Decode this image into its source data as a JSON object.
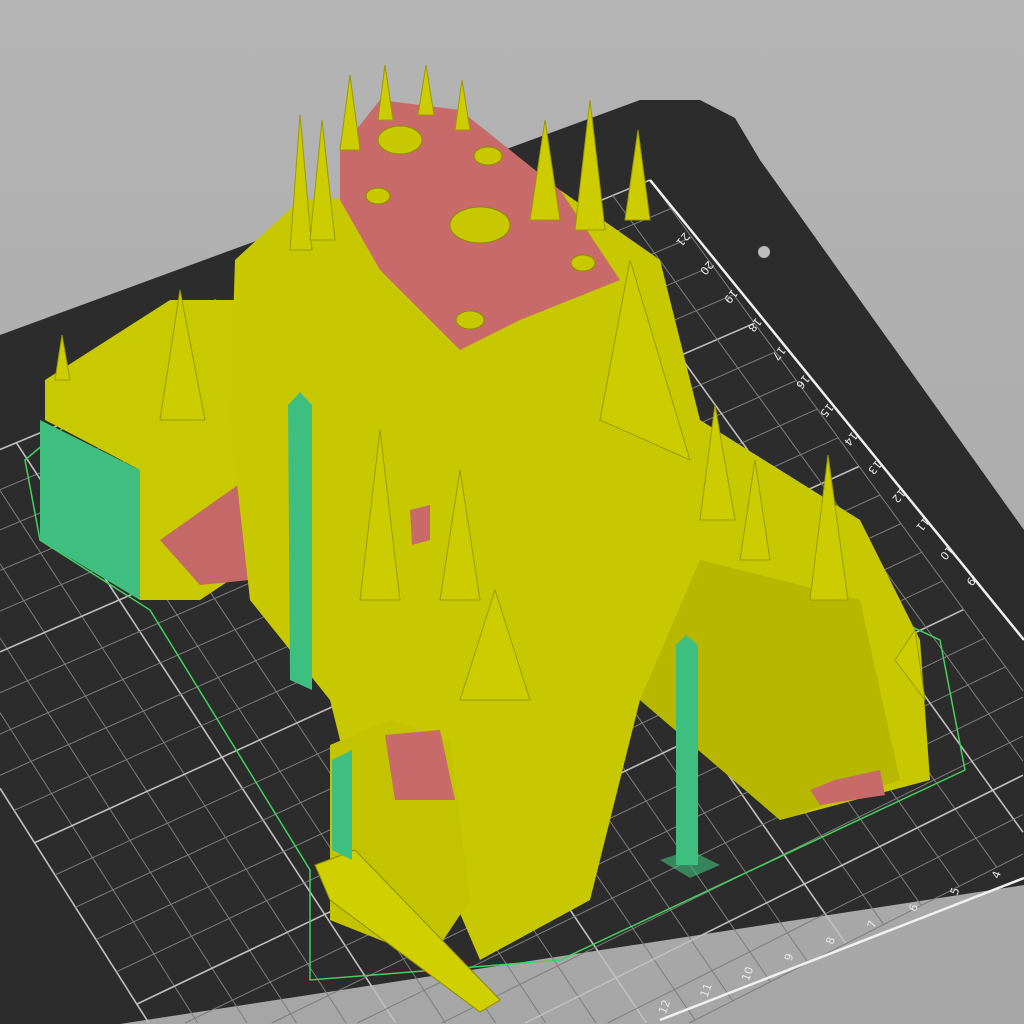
{
  "app": {
    "view": "3D slicer preview"
  },
  "bed": {
    "right_edge_labels": [
      "21",
      "20",
      "19",
      "18",
      "17",
      "16",
      "15",
      "14",
      "13",
      "12",
      "11",
      "10",
      "9"
    ],
    "bottom_edge_labels": [
      "12",
      "11",
      "10",
      "9",
      "8",
      "7",
      "6",
      "5",
      "4"
    ],
    "grid_divisions": 22
  },
  "colors": {
    "background": "#aaaaaa",
    "bed": "#2e2e2e",
    "grid": "#8a8a8a",
    "ruler": "#f0f0f0",
    "perimeter": "#d4d400",
    "top_solid_infill": "#cc6a6a",
    "support": "#3fbf7f",
    "skirt": "#40d060"
  }
}
